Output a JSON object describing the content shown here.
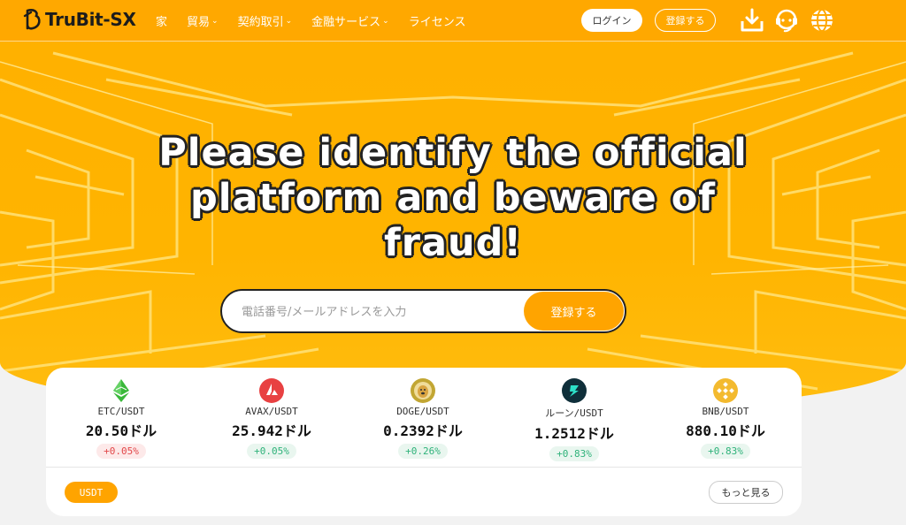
{
  "header": {
    "logo_text": "TruBit-SX",
    "nav": [
      {
        "label": "家",
        "has_caret": false
      },
      {
        "label": "貿易",
        "has_caret": true
      },
      {
        "label": "契約取引",
        "has_caret": true
      },
      {
        "label": "金融サービス",
        "has_caret": true
      },
      {
        "label": "ライセンス",
        "has_caret": false
      }
    ],
    "caret": "⌄",
    "login_label": "ログイン",
    "register_label": "登録する",
    "icons": [
      "download-icon",
      "support-headset-icon",
      "globe-language-icon"
    ]
  },
  "hero": {
    "headline": "Please identify the official platform and beware of fraud!",
    "input_placeholder": "電話番号/メールアドレスを入力",
    "signup_button": "登録する"
  },
  "market": {
    "tickers": [
      {
        "pair": "ETC/USDT",
        "price": "20.50ドル",
        "change": "+0.05%",
        "direction": "negative",
        "icon": "etc-coin-icon",
        "color": "#3ab83a"
      },
      {
        "pair": "AVAX/USDT",
        "price": "25.942ドル",
        "change": "+0.05%",
        "direction": "positive",
        "icon": "avax-coin-icon",
        "color": "#e84142"
      },
      {
        "pair": "DOGE/USDT",
        "price": "0.2392ドル",
        "change": "+0.26%",
        "direction": "positive",
        "icon": "doge-coin-icon",
        "color": "#c2a633"
      },
      {
        "pair": "ルーン/USDT",
        "price": "1.2512ドル",
        "change": "+0.83%",
        "direction": "positive",
        "icon": "rune-coin-icon",
        "color": "#0f2f3a"
      },
      {
        "pair": "BNB/USDT",
        "price": "880.10ドル",
        "change": "+0.83%",
        "direction": "positive",
        "icon": "bnb-coin-icon",
        "color": "#f3ba2f"
      }
    ],
    "tab_label": "USDT",
    "more_label": "もっと見る"
  },
  "colors": {
    "brand_orange": "#ffa400",
    "header_bg": "#ffa800",
    "positive": "#2fb27a",
    "negative": "#e2484a"
  }
}
